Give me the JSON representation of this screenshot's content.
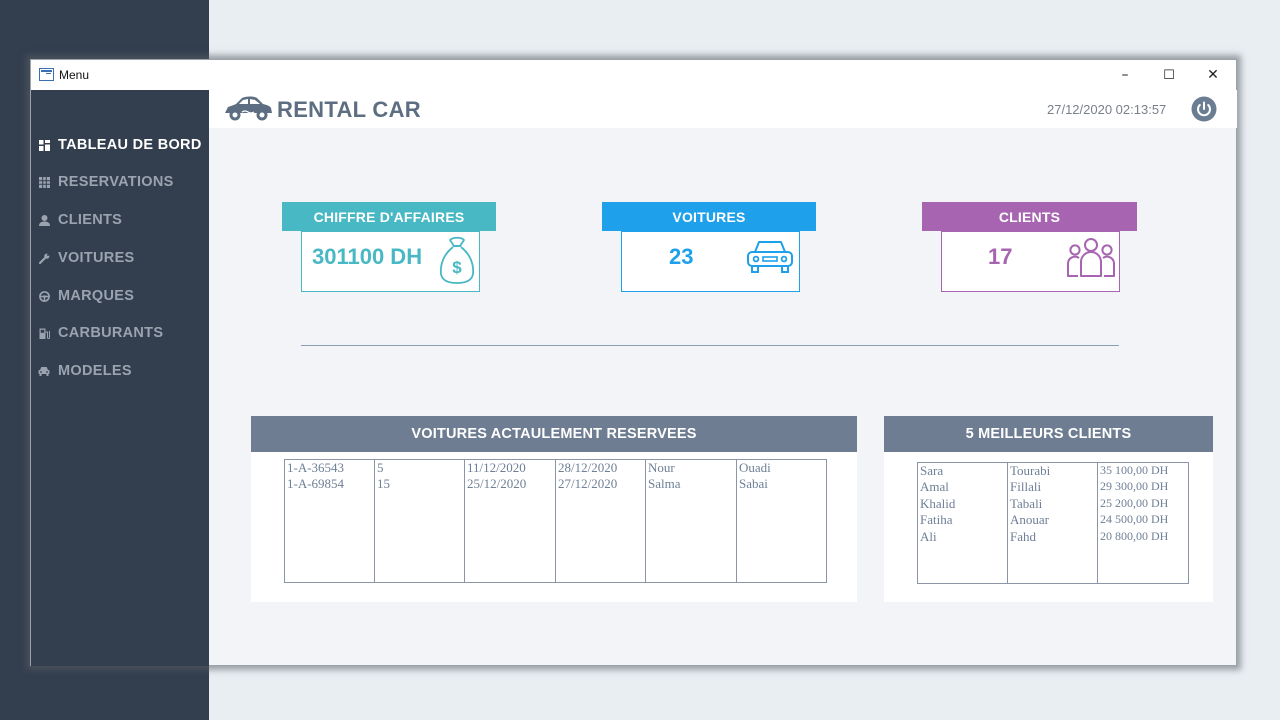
{
  "window": {
    "title": "Menu",
    "controls": {
      "minimize": "–",
      "maximize": "☐",
      "close": "✕"
    }
  },
  "sidebar": {
    "items": [
      {
        "label": "TABLEAU DE BORD",
        "icon": "dashboard-icon",
        "active": true
      },
      {
        "label": "RESERVATIONS",
        "icon": "table-icon"
      },
      {
        "label": "CLIENTS",
        "icon": "user-icon"
      },
      {
        "label": "VOITURES",
        "icon": "wrench-icon"
      },
      {
        "label": "MARQUES",
        "icon": "steering-wheel-icon"
      },
      {
        "label": "CARBURANTS",
        "icon": "fuel-pump-icon"
      },
      {
        "label": "MODELES",
        "icon": "car-icon"
      }
    ]
  },
  "header": {
    "brand": "RENTAL CAR",
    "datetime": "27/12/2020 02:13:57"
  },
  "stats": [
    {
      "title": "CHIFFRE D'AFFAIRES",
      "value": "301100 DH",
      "icon": "money-bag-icon",
      "color": "#47b8c4"
    },
    {
      "title": "VOITURES",
      "value": "23",
      "icon": "car-front-icon",
      "color": "#1ea0ea"
    },
    {
      "title": "CLIENTS",
      "value": "17",
      "icon": "group-icon",
      "color": "#a765b1"
    }
  ],
  "reservations": {
    "title": "VOITURES ACTAULEMENT RESERVEES",
    "rows": [
      [
        "1-A-36543",
        "5",
        "11/12/2020",
        "28/12/2020",
        "Nour",
        "Ouadi"
      ],
      [
        "1-A-69854",
        "15",
        "25/12/2020",
        "27/12/2020",
        "Salma",
        "Sabai"
      ]
    ]
  },
  "top_clients": {
    "title": "5 MEILLEURS CLIENTS",
    "rows": [
      [
        "Sara",
        "Tourabi",
        "35 100,00 DH"
      ],
      [
        "Amal",
        "Fillali",
        "29 300,00 DH"
      ],
      [
        "Khalid",
        "Tabali",
        "25 200,00 DH"
      ],
      [
        "Fatiha",
        "Anouar",
        "24 500,00 DH"
      ],
      [
        "Ali",
        "Fahd",
        "20 800,00 DH"
      ]
    ]
  },
  "colors": {
    "sidebar": "#333e4f",
    "panel_header": "#6e7d91",
    "table_text": "#6e7f96"
  }
}
